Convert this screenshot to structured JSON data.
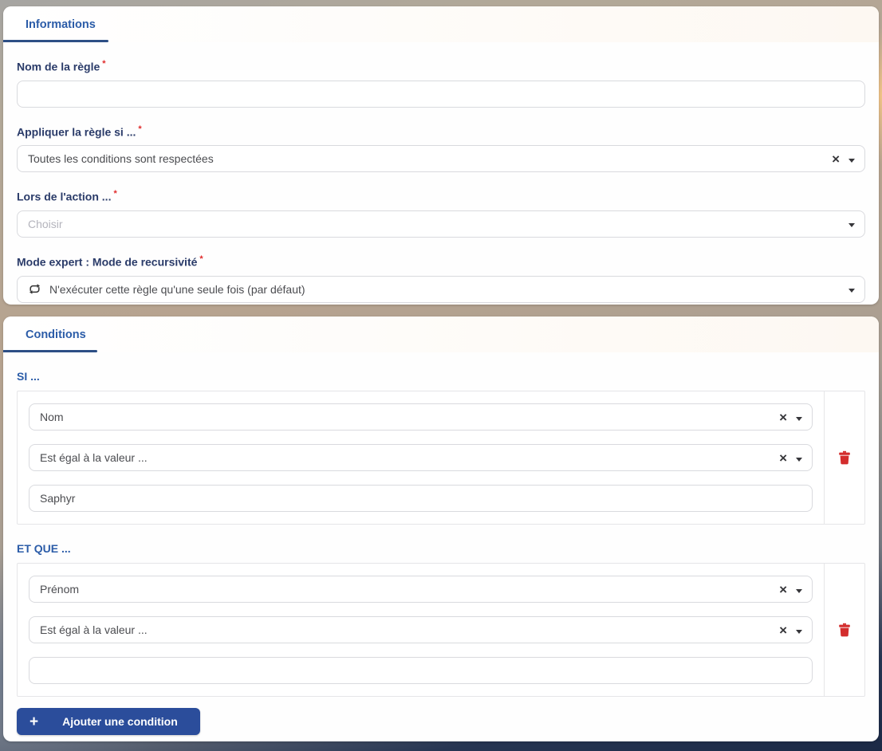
{
  "colors": {
    "accent_blue": "#2b4d9b",
    "tab_blue": "#2b5ca8",
    "tab_underline": "#2d4f85",
    "label_navy": "#2a3b69",
    "required_red": "#e02b2b",
    "trash_red": "#d32d2d",
    "footer_navy": "#1b2946"
  },
  "info_card": {
    "tab_label": "Informations",
    "rule_name": {
      "label": "Nom de la règle",
      "required_mark": "*",
      "value": ""
    },
    "apply_if": {
      "label": "Appliquer la règle si ...",
      "required_mark": "*",
      "selected_value": "Toutes les conditions sont respectées"
    },
    "on_action": {
      "label": "Lors de l'action ...",
      "required_mark": "*",
      "placeholder": "Choisir"
    },
    "recursion_mode": {
      "label": "Mode expert : Mode de recursivité",
      "required_mark": "*",
      "selected_value": "N'exécuter cette règle qu'une seule fois (par défaut)",
      "icon": "repeat-icon"
    }
  },
  "conditions_card": {
    "tab_label": "Conditions",
    "groups": [
      {
        "heading": "SI ...",
        "field": "Nom",
        "operator": "Est égal à la valeur ...",
        "value": "Saphyr"
      },
      {
        "heading": "ET QUE ...",
        "field": "Prénom",
        "operator": "Est égal à la valeur ...",
        "value": ""
      }
    ],
    "add_button": {
      "icon_glyph": "+",
      "label": "Ajouter une condition"
    }
  },
  "icons": {
    "clear_glyph": "×",
    "caret": "chevron-down",
    "delete": "trash",
    "recursion": "repeat"
  }
}
